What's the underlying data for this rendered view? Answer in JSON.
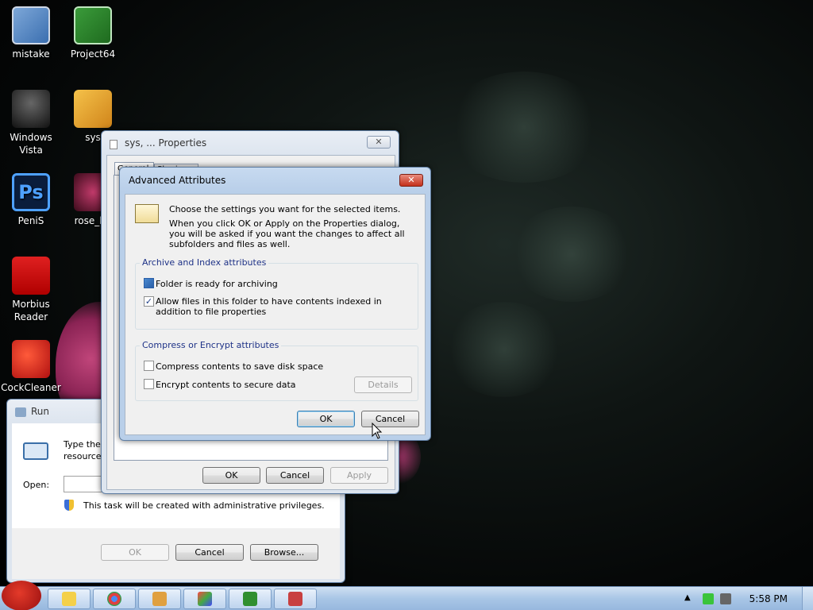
{
  "desktop": {
    "icons": [
      {
        "label": "mistake"
      },
      {
        "label": "Project64"
      },
      {
        "label": "Windows Vista"
      },
      {
        "label": "sys"
      },
      {
        "label": "PeniS"
      },
      {
        "label": "rose_bu"
      },
      {
        "label": "Morbius Reader"
      },
      {
        "label": "CockCleaner"
      }
    ]
  },
  "properties_window": {
    "title": "sys, ... Properties",
    "close_glyph": "✕",
    "tabs": [
      "General",
      "Sharing"
    ],
    "ok_label": "OK",
    "cancel_label": "Cancel",
    "apply_label": "Apply"
  },
  "advanced_dialog": {
    "title": "Advanced Attributes",
    "close_glyph": "✕",
    "intro": "Choose the settings you want for the selected items.",
    "description": "When you click OK or Apply on the Properties dialog, you will be asked if you want the changes to affect all subfolders and files as well.",
    "archive_group": {
      "label": "Archive and Index attributes",
      "items": [
        {
          "label": "Folder is ready for archiving",
          "checked": "filled"
        },
        {
          "label": "Allow files in this folder to have contents indexed in addition to file properties",
          "checked": "check"
        }
      ]
    },
    "compress_group": {
      "label": "Compress or Encrypt attributes",
      "items": [
        {
          "label": "Compress contents to save disk space",
          "checked": "none"
        },
        {
          "label": "Encrypt contents to secure data",
          "checked": "none"
        }
      ],
      "details_label": "Details"
    },
    "ok_label": "OK",
    "cancel_label": "Cancel",
    "check_glyph": "✓"
  },
  "run_dialog": {
    "title": "Run",
    "description_line1": "Type the",
    "description_line2": "resource,",
    "open_label": "Open:",
    "open_value": "",
    "admin_note": "This task will be created with administrative privileges.",
    "ok_label": "OK",
    "cancel_label": "Cancel",
    "browse_label": "Browse..."
  },
  "taskbar": {
    "clock": "5:58 PM",
    "buttons": [
      "explorer",
      "chrome",
      "package",
      "paint",
      "project64",
      "media",
      "run"
    ]
  }
}
